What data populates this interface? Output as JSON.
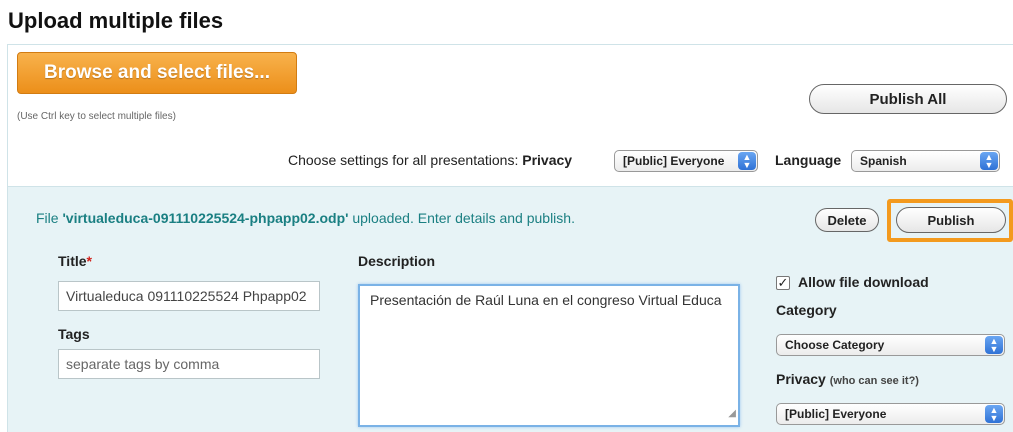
{
  "page": {
    "title": "Upload multiple files"
  },
  "uploader": {
    "browse_label": "Browse and select files...",
    "hint": "(Use Ctrl key to select multiple files)",
    "publish_all_label": "Publish All"
  },
  "global_settings": {
    "label_prefix": "Choose settings for all presentations:",
    "privacy_label": "Privacy",
    "privacy_value": "[Public] Everyone",
    "language_label": "Language",
    "language_value": "Spanish"
  },
  "file_item": {
    "status_prefix": "File",
    "filename": "'virtualeduca-091110225524-phpapp02.odp'",
    "status_suffix": "uploaded. Enter details and publish.",
    "delete_label": "Delete",
    "publish_label": "Publish",
    "title_label": "Title",
    "required_mark": "*",
    "title_value": "Virtualeduca 091110225524 Phpapp02",
    "tags_label": "Tags",
    "tags_placeholder": "separate tags by comma",
    "description_label": "Description",
    "description_value": "Presentación de Raúl Luna en el congreso Virtual Educa",
    "allow_download_label": "Allow file download",
    "allow_download_checked": true,
    "category_label": "Category",
    "category_value": "Choose Category",
    "privacy_label": "Privacy",
    "privacy_note": "(who can see it?)",
    "privacy_value": "[Public] Everyone"
  },
  "colors": {
    "accent_orange": "#ec8f1a",
    "panel_bg": "#e7f3f6",
    "status_teal": "#1a7f82",
    "required_red": "#d0201a"
  }
}
